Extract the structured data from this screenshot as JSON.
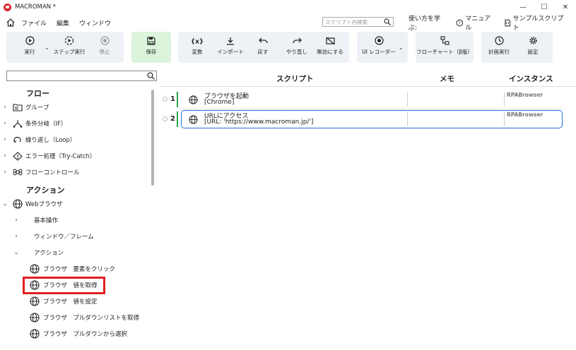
{
  "window": {
    "title": "MACROMAN *",
    "controls": [
      "—",
      "☐",
      "✕"
    ]
  },
  "menu": {
    "items": [
      "ファイル",
      "編集",
      "ウィンドウ"
    ],
    "search_placeholder": "スクリプト内検索",
    "learn": "使い方を学ぶ:",
    "manual": "マニュアル",
    "samples": "サンプルスクリプト"
  },
  "toolbar": {
    "run": "実行",
    "step": "ステップ実行",
    "stop": "停止",
    "save": "保存",
    "variable": "変数",
    "import": "インポート",
    "undo": "戻す",
    "redo": "やり直し",
    "disable": "無効にする",
    "ui_recorder": "UI レコーダー",
    "flowchart": "フローチャート（β版）",
    "schedule": "計画実行",
    "settings": "設定"
  },
  "left": {
    "flow_heading": "フロー",
    "flow_items": [
      "グループ",
      "条件分岐（IF）",
      "繰り返し（Loop）",
      "エラー処理（Try-Catch）",
      "フローコントロール"
    ],
    "action_heading": "アクション",
    "web_browser": "Webブラウザ",
    "sub_items": [
      "基本操作",
      "ウィンドウ／フレーム",
      "アクション"
    ],
    "actions": [
      "ブラウザ　要素をクリック",
      "ブラウザ　値を取得",
      "ブラウザ　値を設定",
      "ブラウザ　プルダウンリストを取得",
      "ブラウザ　プルダウンから選択"
    ]
  },
  "main": {
    "headers": {
      "script": "スクリプト",
      "memo": "メモ",
      "instance": "インスタンス"
    },
    "rows": [
      {
        "num": "1",
        "title": "ブラウザを起動",
        "sub": "[Chrome]",
        "instance": "RPABrowser"
      },
      {
        "num": "2",
        "title": "URLにアクセス",
        "sub": "[URL: 'https://www.macroman.jp/']",
        "instance": "RPABrowser"
      }
    ]
  }
}
